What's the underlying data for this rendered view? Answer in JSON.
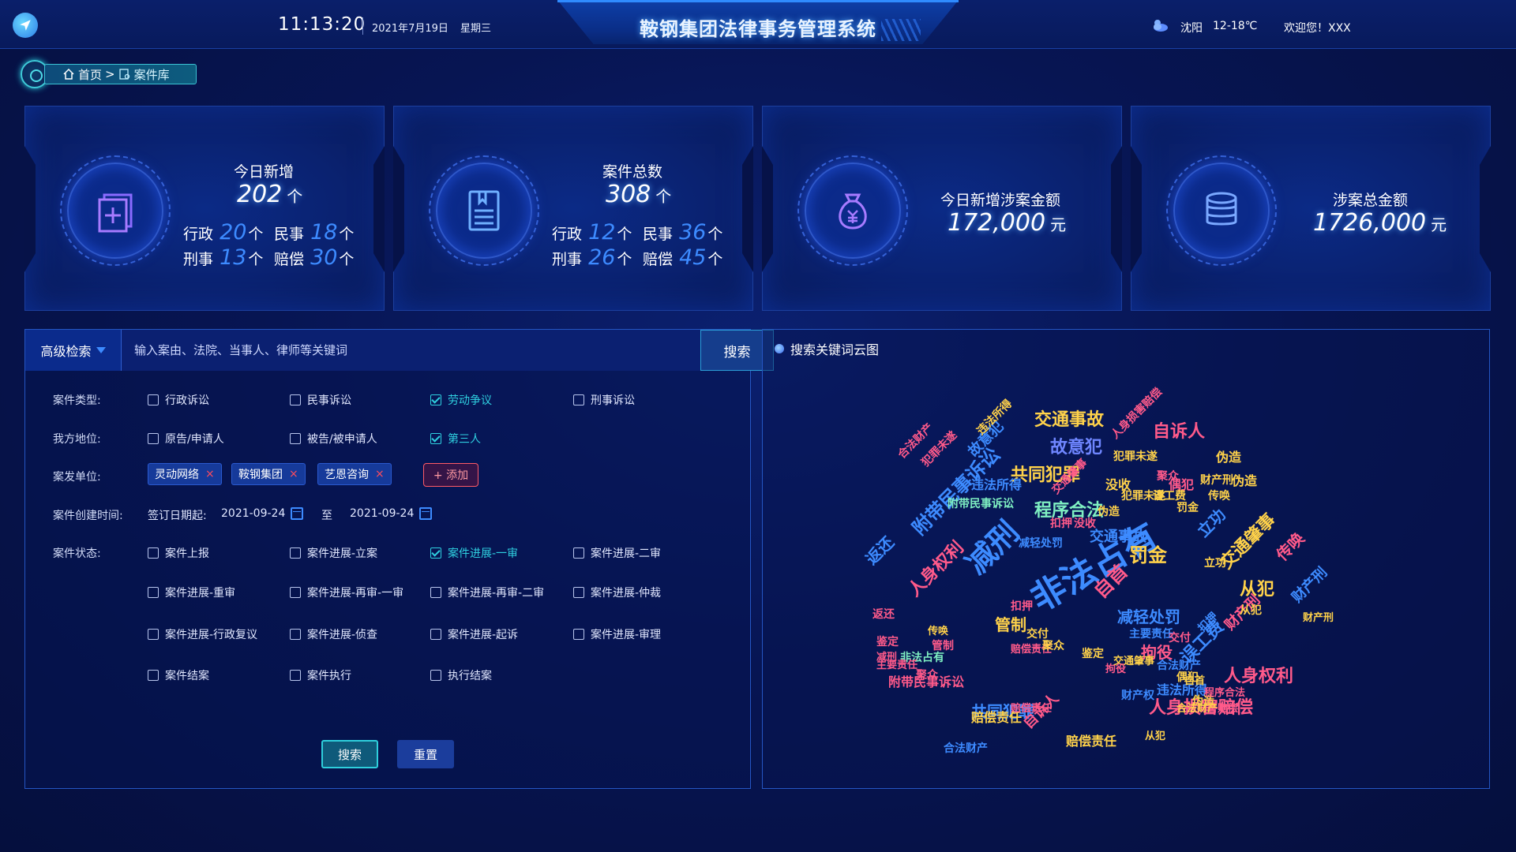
{
  "header": {
    "time": "11:13:20",
    "date": "2021年7月19日",
    "weekday": "星期三",
    "title": "鞍钢集团法律事务管理系统",
    "city": "沈阳",
    "temperature": "12-18℃",
    "welcome": "欢迎您！XXX"
  },
  "breadcrumb": {
    "home": "首页",
    "separator": ">",
    "current": "案件库"
  },
  "stats": [
    {
      "title": "今日新增",
      "value": "202",
      "unit": "个",
      "items": [
        {
          "label": "行政",
          "value": "20",
          "unit": "个"
        },
        {
          "label": "民事",
          "value": "18",
          "unit": "个"
        },
        {
          "label": "刑事",
          "value": "13",
          "unit": "个"
        },
        {
          "label": "赔偿",
          "value": "30",
          "unit": "个"
        }
      ]
    },
    {
      "title": "案件总数",
      "value": "308",
      "unit": "个",
      "items": [
        {
          "label": "行政",
          "value": "12",
          "unit": "个"
        },
        {
          "label": "民事",
          "value": "36",
          "unit": "个"
        },
        {
          "label": "刑事",
          "value": "26",
          "unit": "个"
        },
        {
          "label": "赔偿",
          "value": "45",
          "unit": "个"
        }
      ]
    },
    {
      "title": "今日新增涉案金额",
      "value": "172,000",
      "unit": "元"
    },
    {
      "title": "涉案总金额",
      "value": "1726,000",
      "unit": "元"
    }
  ],
  "search": {
    "advanced_label": "高级检索",
    "placeholder": "输入案由、法院、当事人、律师等关键词",
    "button": "搜索"
  },
  "filters": {
    "case_type": {
      "label": "案件类型:",
      "options": [
        {
          "text": "行政诉讼",
          "checked": false
        },
        {
          "text": "民事诉讼",
          "checked": false
        },
        {
          "text": "劳动争议",
          "checked": true
        },
        {
          "text": "刑事诉讼",
          "checked": false
        }
      ]
    },
    "our_position": {
      "label": "我方地位:",
      "options": [
        {
          "text": "原告/申请人",
          "checked": false
        },
        {
          "text": "被告/被申请人",
          "checked": false
        },
        {
          "text": "第三人",
          "checked": true
        }
      ]
    },
    "unit": {
      "label": "案发单位:",
      "tags": [
        "灵动网络",
        "鞍钢集团",
        "艺恩咨询"
      ],
      "tag_remove": "×",
      "add": "+ 添加"
    },
    "created_time": {
      "label": "案件创建时间:",
      "sign_label": "签订日期起:",
      "start": "2021-09-24",
      "to": "至",
      "end": "2021-09-24"
    },
    "status": {
      "label": "案件状态:",
      "options": [
        {
          "text": "案件上报",
          "checked": false
        },
        {
          "text": "案件进展-立案",
          "checked": false
        },
        {
          "text": "案件进展-一审",
          "checked": true
        },
        {
          "text": "案件进展-二审",
          "checked": false
        },
        {
          "text": "案件进展-重审",
          "checked": false
        },
        {
          "text": "案件进展-再审-一审",
          "checked": false
        },
        {
          "text": "案件进展-再审-二审",
          "checked": false
        },
        {
          "text": "案件进展-仲裁",
          "checked": false
        },
        {
          "text": "案件进展-行政复议",
          "checked": false
        },
        {
          "text": "案件进展-侦查",
          "checked": false
        },
        {
          "text": "案件进展-起诉",
          "checked": false
        },
        {
          "text": "案件进展-审理",
          "checked": false
        },
        {
          "text": "案件结案",
          "checked": false
        },
        {
          "text": "案件执行",
          "checked": false
        },
        {
          "text": "执行结案",
          "checked": false
        }
      ]
    },
    "search_button": "搜索",
    "reset_button": "重置"
  },
  "wordcloud": {
    "title": "搜索关键词云图",
    "words": [
      {
        "text": "非法占有",
        "size": 44,
        "color": "#3d8bff",
        "rot": -30
      },
      {
        "text": "减刑",
        "size": 38,
        "color": "#3d8bff",
        "rot": -45
      },
      {
        "text": "交通事故",
        "size": 22,
        "color": "#ffd24a",
        "rot": 0
      },
      {
        "text": "自诉人",
        "size": 22,
        "color": "#ff5a8a",
        "rot": 0
      },
      {
        "text": "故意犯",
        "size": 22,
        "color": "#6f86ff",
        "rot": 0
      },
      {
        "text": "共同犯罪",
        "size": 22,
        "color": "#ffd24a",
        "rot": 0
      },
      {
        "text": "程序合法",
        "size": 22,
        "color": "#7ff0c2",
        "rot": 0
      },
      {
        "text": "附带民事诉讼",
        "size": 24,
        "color": "#3d8bff",
        "rot": -45
      },
      {
        "text": "人身权利",
        "size": 22,
        "color": "#ff5a8a",
        "rot": -45
      },
      {
        "text": "罚金",
        "size": 24,
        "color": "#ffd24a",
        "rot": 0
      },
      {
        "text": "自首",
        "size": 24,
        "color": "#ff5a8a",
        "rot": -45
      },
      {
        "text": "交通肇事",
        "size": 22,
        "color": "#ffd24a",
        "rot": -45
      },
      {
        "text": "从犯",
        "size": 22,
        "color": "#ffd24a",
        "rot": 0
      },
      {
        "text": "传唤",
        "size": 20,
        "color": "#ff5a8a",
        "rot": -45
      },
      {
        "text": "减轻处罚",
        "size": 20,
        "color": "#3d8bff",
        "rot": 0
      },
      {
        "text": "拘役",
        "size": 20,
        "color": "#ff5a8a",
        "rot": 0
      },
      {
        "text": "管制",
        "size": 20,
        "color": "#ffd24a",
        "rot": 0
      },
      {
        "text": "误工费",
        "size": 22,
        "color": "#3d8bff",
        "rot": -45
      },
      {
        "text": "人身权利",
        "size": 22,
        "color": "#ff5a8a",
        "rot": 0
      },
      {
        "text": "人身损害赔偿",
        "size": 22,
        "color": "#ff5a8a",
        "rot": 0
      },
      {
        "text": "共同犯罪",
        "size": 20,
        "color": "#3d8bff",
        "rot": 0
      },
      {
        "text": "附带民事诉讼",
        "size": 16,
        "color": "#ff5a8a",
        "rot": 0
      },
      {
        "text": "赔偿责任",
        "size": 16,
        "color": "#ffd24a",
        "rot": 0
      },
      {
        "text": "合法财产",
        "size": 14,
        "color": "#3d8bff",
        "rot": 0
      },
      {
        "text": "违法所得",
        "size": 16,
        "color": "#3d8bff",
        "rot": 0
      },
      {
        "text": "财产刑",
        "size": 18,
        "color": "#ff5a8a",
        "rot": -45
      },
      {
        "text": "犯罪未遂",
        "size": 14,
        "color": "#ffd24a",
        "rot": 0
      },
      {
        "text": "没收",
        "size": 16,
        "color": "#ffd24a",
        "rot": 0
      },
      {
        "text": "伪造",
        "size": 16,
        "color": "#ffd24a",
        "rot": 0
      },
      {
        "text": "偶犯",
        "size": 16,
        "color": "#ff5a8a",
        "rot": 0
      },
      {
        "text": "立功",
        "size": 20,
        "color": "#3d8bff",
        "rot": -45
      },
      {
        "text": "返还",
        "size": 20,
        "color": "#3d8bff",
        "rot": -45
      },
      {
        "text": "鉴定",
        "size": 14,
        "color": "#ff5a8a",
        "rot": 0
      },
      {
        "text": "聚众",
        "size": 14,
        "color": "#ff5a8a",
        "rot": 0
      },
      {
        "text": "扣押",
        "size": 14,
        "color": "#ff5a8a",
        "rot": 0
      },
      {
        "text": "主要责任",
        "size": 14,
        "color": "#3d8bff",
        "rot": 0
      },
      {
        "text": "交付",
        "size": 14,
        "color": "#ffd24a",
        "rot": 0
      },
      {
        "text": "财产权",
        "size": 14,
        "color": "#3d8bff",
        "rot": 0
      },
      {
        "text": "合法财产",
        "size": 14,
        "color": "#ff5a8a",
        "rot": -45
      },
      {
        "text": "故意犯",
        "size": 18,
        "color": "#3d8bff",
        "rot": -45
      },
      {
        "text": "犯罪未遂",
        "size": 14,
        "color": "#ff5a8a",
        "rot": -45
      },
      {
        "text": "违法所得",
        "size": 14,
        "color": "#ffd24a",
        "rot": -45
      },
      {
        "text": "从犯",
        "size": 14,
        "color": "#ffd24a",
        "rot": 0
      },
      {
        "text": "返还",
        "size": 14,
        "color": "#ff5a8a",
        "rot": 0
      },
      {
        "text": "非法占有",
        "size": 14,
        "color": "#7ff0c2",
        "rot": 0
      },
      {
        "text": "主要责任",
        "size": 13,
        "color": "#ff5a8a",
        "rot": 0
      },
      {
        "text": "减刑",
        "size": 13,
        "color": "#ff5a8a",
        "rot": 0
      },
      {
        "text": "财产刑",
        "size": 13,
        "color": "#ffd24a",
        "rot": 0
      },
      {
        "text": "人身损害赔偿",
        "size": 13,
        "color": "#ff5a8a",
        "rot": 0
      },
      {
        "text": "合法财产",
        "size": 13,
        "color": "#ffd24a",
        "rot": 0
      },
      {
        "text": "犯罪未遂",
        "size": 14,
        "color": "#ffd24a",
        "rot": 0
      },
      {
        "text": "财产刑",
        "size": 14,
        "color": "#ffd24a",
        "rot": 0
      },
      {
        "text": "误工费",
        "size": 14,
        "color": "#ffd24a",
        "rot": 0
      },
      {
        "text": "伪造",
        "size": 16,
        "color": "#ffd24a",
        "rot": 0
      },
      {
        "text": "赔偿责任",
        "size": 13,
        "color": "#ff5a8a",
        "rot": 0
      },
      {
        "text": "交通肇事",
        "size": 13,
        "color": "#ffd24a",
        "rot": 0
      },
      {
        "text": "自首",
        "size": 13,
        "color": "#ffd24a",
        "rot": 0
      },
      {
        "text": "自诉人",
        "size": 18,
        "color": "#ff5a8a",
        "rot": -45
      },
      {
        "text": "财产刑",
        "size": 18,
        "color": "#3d8bff",
        "rot": -45
      },
      {
        "text": "拘役",
        "size": 13,
        "color": "#ff5a8a",
        "rot": 0
      },
      {
        "text": "从犯",
        "size": 13,
        "color": "#ffd24a",
        "rot": 0
      },
      {
        "text": "偶犯",
        "size": 14,
        "color": "#ffd24a",
        "rot": 0
      },
      {
        "text": "伪造",
        "size": 14,
        "color": "#ffd24a",
        "rot": 0
      },
      {
        "text": "赔偿责任",
        "size": 16,
        "color": "#ffd24a",
        "rot": 0
      },
      {
        "text": "合法财产",
        "size": 14,
        "color": "#3d8bff",
        "rot": 0
      },
      {
        "text": "扣押",
        "size": 14,
        "color": "#ff5a8a",
        "rot": 0
      },
      {
        "text": "程序合法",
        "size": 13,
        "color": "#ff5a8a",
        "rot": 0
      },
      {
        "text": "赔偿责任",
        "size": 13,
        "color": "#ff5a8a",
        "rot": 0
      },
      {
        "text": "聚众",
        "size": 14,
        "color": "#ff5a8a",
        "rot": 0
      },
      {
        "text": "违法所得",
        "size": 16,
        "color": "#3d8bff",
        "rot": 0
      },
      {
        "text": "罚金",
        "size": 14,
        "color": "#ffd24a",
        "rot": 0
      },
      {
        "text": "没收",
        "size": 14,
        "color": "#ff5a8a",
        "rot": 0
      },
      {
        "text": "鉴定",
        "size": 14,
        "color": "#ffd24a",
        "rot": 0
      },
      {
        "text": "附带民事诉讼",
        "size": 14,
        "color": "#7ff0c2",
        "rot": 0
      },
      {
        "text": "传唤",
        "size": 13,
        "color": "#ffd24a",
        "rot": 0
      },
      {
        "text": "管制",
        "size": 14,
        "color": "#ff5a8a",
        "rot": 0
      },
      {
        "text": "聚众",
        "size": 14,
        "color": "#ffd24a",
        "rot": 0
      },
      {
        "text": "交付",
        "size": 14,
        "color": "#ff5a8a",
        "rot": 0
      },
      {
        "text": "交通事故",
        "size": 18,
        "color": "#3d8bff",
        "rot": 0
      },
      {
        "text": "交通肇事",
        "size": 14,
        "color": "#ff5a8a",
        "rot": -45
      },
      {
        "text": "人身损害赔偿",
        "size": 14,
        "color": "#ff5a8a",
        "rot": -45
      },
      {
        "text": "立功",
        "size": 14,
        "color": "#ffd24a",
        "rot": 0
      },
      {
        "text": "减轻处罚",
        "size": 14,
        "color": "#3d8bff",
        "rot": 0
      },
      {
        "text": "传唤",
        "size": 14,
        "color": "#ffd24a",
        "rot": 0
      },
      {
        "text": "伪造",
        "size": 14,
        "color": "#ffd24a",
        "rot": 0
      },
      {
        "text": "扣押",
        "size": 14,
        "color": "#3d8bff",
        "rot": -45
      }
    ]
  }
}
